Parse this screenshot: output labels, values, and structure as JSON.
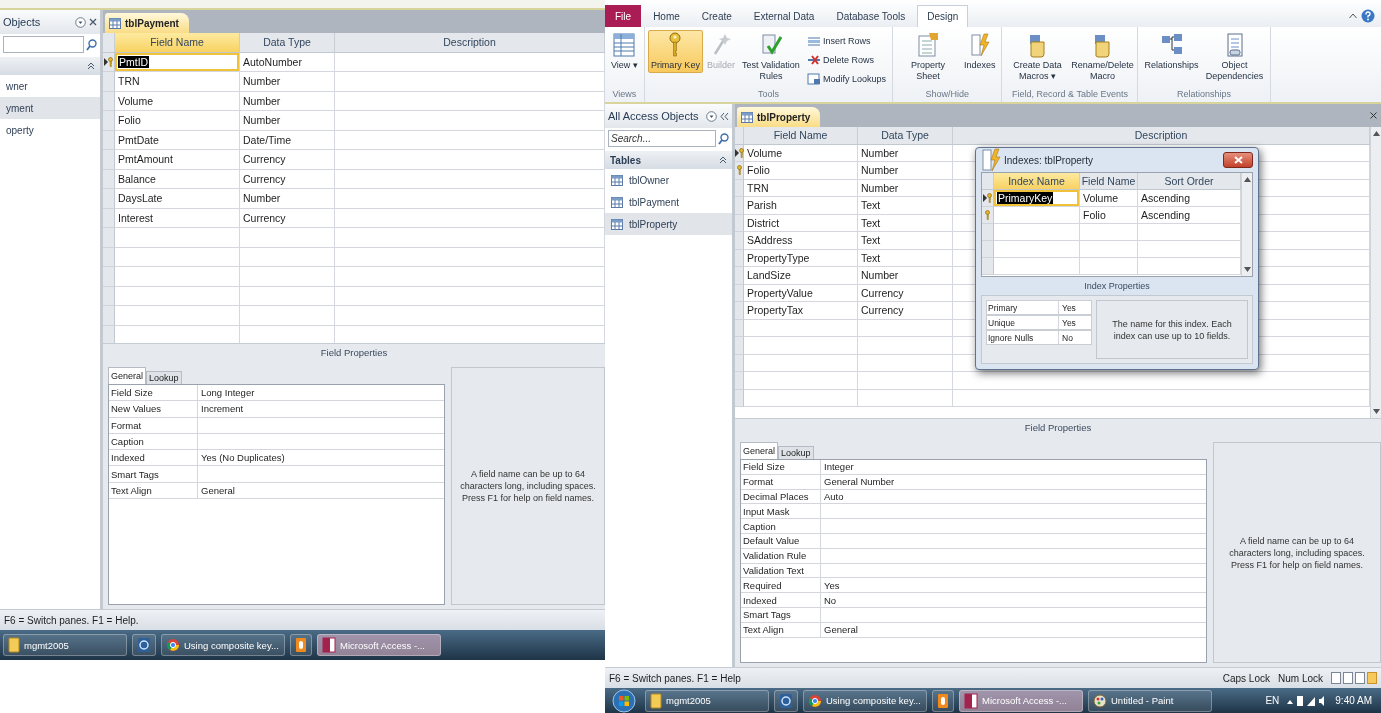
{
  "left_window": {
    "nav_pane": {
      "title": "Objects",
      "items": [
        {
          "label": "wner",
          "selected": false
        },
        {
          "label": "yment",
          "selected": true
        },
        {
          "label": "operty",
          "selected": false
        }
      ]
    },
    "document_tab": "tblPayment",
    "design_grid": {
      "columns": [
        {
          "label": "Field Name",
          "selected": true
        },
        {
          "label": "Data Type",
          "selected": false
        },
        {
          "label": "Description",
          "selected": false
        }
      ],
      "rows": [
        {
          "field_name": "PmtID",
          "data_type": "AutoNumber",
          "primary_key": true,
          "selected": true
        },
        {
          "field_name": "TRN",
          "data_type": "Number",
          "primary_key": false,
          "selected": false
        },
        {
          "field_name": "Volume",
          "data_type": "Number",
          "primary_key": false,
          "selected": false
        },
        {
          "field_name": "Folio",
          "data_type": "Number",
          "primary_key": false,
          "selected": false
        },
        {
          "field_name": "PmtDate",
          "data_type": "Date/Time",
          "primary_key": false,
          "selected": false
        },
        {
          "field_name": "PmtAmount",
          "data_type": "Currency",
          "primary_key": false,
          "selected": false
        },
        {
          "field_name": "Balance",
          "data_type": "Currency",
          "primary_key": false,
          "selected": false
        },
        {
          "field_name": "DaysLate",
          "data_type": "Number",
          "primary_key": false,
          "selected": false
        },
        {
          "field_name": "Interest",
          "data_type": "Currency",
          "primary_key": false,
          "selected": false
        }
      ]
    },
    "field_properties_title": "Field Properties",
    "property_tabs": [
      {
        "label": "General",
        "selected": true
      },
      {
        "label": "Lookup",
        "selected": false
      }
    ],
    "properties": [
      {
        "name": "Field Size",
        "value": "Long Integer"
      },
      {
        "name": "New Values",
        "value": "Increment"
      },
      {
        "name": "Format"
      },
      {
        "name": "Caption"
      },
      {
        "name": "Indexed",
        "value": "Yes (No Duplicates)"
      },
      {
        "name": "Smart Tags"
      },
      {
        "name": "Text Align",
        "value": "General"
      }
    ],
    "help_text": "A field name can be up to 64 characters long, including spaces. Press F1 for help on field names.",
    "status_bar": {
      "text": "F6 = Switch panes.  F1 = Help."
    },
    "taskbar": {
      "items": [
        {
          "kind": "folder",
          "label": "mgmt2005",
          "selected": false
        },
        {
          "kind": "blue-app",
          "selected": false
        },
        {
          "kind": "browser",
          "label": "Using composite key...",
          "selected": false
        },
        {
          "kind": "orange-app",
          "selected": false
        },
        {
          "kind": "access",
          "label": "Microsoft Access -...",
          "selected": true
        }
      ]
    }
  },
  "right_window": {
    "ribbon": {
      "tabs": [
        {
          "kind": "file",
          "label": "File",
          "selected": false
        },
        {
          "kind": "tab",
          "label": "Home",
          "selected": false
        },
        {
          "kind": "tab",
          "label": "Create",
          "selected": false
        },
        {
          "kind": "tab",
          "label": "External Data",
          "selected": false
        },
        {
          "kind": "tab",
          "label": "Database Tools",
          "selected": false
        },
        {
          "kind": "tab",
          "label": "Design",
          "selected": true
        }
      ],
      "groups": [
        {
          "label": "Views",
          "buttons": [
            {
              "kind": "large",
              "label": "View",
              "arrow": "▾",
              "selected": false,
              "disabled": false
            }
          ]
        },
        {
          "label": "Tools",
          "buttons": [
            {
              "kind": "large",
              "label": "Primary Key",
              "selected": true,
              "disabled": false
            },
            {
              "kind": "large",
              "label": "Builder",
              "selected": false,
              "disabled": true
            },
            {
              "kind": "large",
              "label": "Test Validation Rules",
              "selected": false,
              "disabled": false
            },
            {
              "kind": "small",
              "label": "Insert Rows",
              "selected": false,
              "disabled": false
            },
            {
              "kind": "small",
              "label": "Delete Rows",
              "selected": false,
              "disabled": false
            },
            {
              "kind": "small",
              "label": "Modify Lookups",
              "selected": false,
              "disabled": false
            }
          ]
        },
        {
          "label": "Show/Hide",
          "buttons": [
            {
              "kind": "large",
              "label": "Property Sheet",
              "selected": false,
              "disabled": false
            },
            {
              "kind": "large",
              "label": "Indexes",
              "selected": false,
              "disabled": false
            }
          ]
        },
        {
          "label": "Field, Record & Table Events",
          "buttons": [
            {
              "kind": "large",
              "label": "Create Data Macros",
              "arrow": "▾",
              "selected": false,
              "disabled": false
            },
            {
              "kind": "large",
              "label": "Rename/Delete Macro",
              "selected": false,
              "disabled": false
            }
          ]
        },
        {
          "label": "Relationships",
          "buttons": [
            {
              "kind": "large",
              "label": "Relationships",
              "selected": false,
              "disabled": false
            },
            {
              "kind": "large",
              "label": "Object Dependencies",
              "selected": false,
              "disabled": false
            }
          ]
        }
      ]
    },
    "nav_pane": {
      "title": "All Access Objects",
      "search": {
        "placeholder": "Search..."
      },
      "group_label": "Tables",
      "items": [
        {
          "label": "tblOwner",
          "selected": false
        },
        {
          "label": "tblPayment",
          "selected": false
        },
        {
          "label": "tblProperty",
          "selected": true
        }
      ]
    },
    "document_tab": "tblProperty",
    "design_grid": {
      "columns": [
        {
          "label": "Field Name",
          "selected": false
        },
        {
          "label": "Data Type",
          "selected": false
        },
        {
          "label": "Description",
          "selected": false
        }
      ],
      "rows": [
        {
          "field_name": "Volume",
          "data_type": "Number",
          "primary_key": true,
          "selected": true
        },
        {
          "field_name": "Folio",
          "data_type": "Number",
          "primary_key": true,
          "selected": false
        },
        {
          "field_name": "TRN",
          "data_type": "Number",
          "primary_key": false,
          "selected": false
        },
        {
          "field_name": "Parish",
          "data_type": "Text",
          "primary_key": false,
          "selected": false
        },
        {
          "field_name": "District",
          "data_type": "Text",
          "primary_key": false,
          "selected": false
        },
        {
          "field_name": "SAddress",
          "data_type": "Text",
          "primary_key": false,
          "selected": false
        },
        {
          "field_name": "PropertyType",
          "data_type": "Text",
          "primary_key": false,
          "selected": false
        },
        {
          "field_name": "LandSize",
          "data_type": "Number",
          "primary_key": false,
          "selected": false
        },
        {
          "field_name": "PropertyValue",
          "data_type": "Currency",
          "primary_key": false,
          "selected": false
        },
        {
          "field_name": "PropertyTax",
          "data_type": "Currency",
          "primary_key": false,
          "selected": false
        }
      ]
    },
    "indexes_dialog": {
      "title": "Indexes: tblProperty",
      "columns": [
        {
          "label": "Index Name",
          "selected": true
        },
        {
          "label": "Field Name",
          "selected": false
        },
        {
          "label": "Sort Order",
          "selected": false
        }
      ],
      "rows": [
        {
          "index_name": "PrimaryKey",
          "field_name": "Volume",
          "sort_order": "Ascending",
          "primary_key": true,
          "selected": true
        },
        {
          "field_name": "Folio",
          "sort_order": "Ascending",
          "primary_key": true,
          "selected": false
        }
      ],
      "properties_title": "Index Properties",
      "properties": [
        {
          "name": "Primary",
          "value": "Yes"
        },
        {
          "name": "Unique",
          "value": "Yes"
        },
        {
          "name": "Ignore Nulls",
          "value": "No"
        }
      ],
      "help_text": "The name for this index. Each index can use up to 10 fields."
    },
    "field_properties_title": "Field Properties",
    "property_tabs": [
      {
        "label": "General",
        "selected": true
      },
      {
        "label": "Lookup",
        "selected": false
      }
    ],
    "properties": [
      {
        "name": "Field Size",
        "value": "Integer"
      },
      {
        "name": "Format",
        "value": "General Number"
      },
      {
        "name": "Decimal Places",
        "value": "Auto"
      },
      {
        "name": "Input Mask"
      },
      {
        "name": "Caption"
      },
      {
        "name": "Default Value"
      },
      {
        "name": "Validation Rule"
      },
      {
        "name": "Validation Text"
      },
      {
        "name": "Required",
        "value": "Yes"
      },
      {
        "name": "Indexed",
        "value": "No"
      },
      {
        "name": "Smart Tags"
      },
      {
        "name": "Text Align",
        "value": "General"
      }
    ],
    "help_text": "A field name can be up to 64 characters long, including spaces. Press F1 for help on field names.",
    "status_bar": {
      "text": "F6 = Switch panes.  F1 = Help",
      "indicators": [
        "Caps Lock",
        "Num Lock"
      ]
    },
    "taskbar": {
      "items": [
        {
          "kind": "start",
          "selected": false
        },
        {
          "kind": "folder",
          "label": "mgmt2005",
          "selected": false
        },
        {
          "kind": "blue-app",
          "selected": false
        },
        {
          "kind": "browser",
          "label": "Using composite key...",
          "selected": false
        },
        {
          "kind": "orange-app",
          "selected": false
        },
        {
          "kind": "access",
          "label": "Microsoft Access -...",
          "selected": true
        },
        {
          "kind": "paint",
          "label": "Untitled - Paint",
          "selected": false
        }
      ],
      "tray": {
        "language": "EN",
        "clock": "9:40 AM"
      }
    }
  }
}
